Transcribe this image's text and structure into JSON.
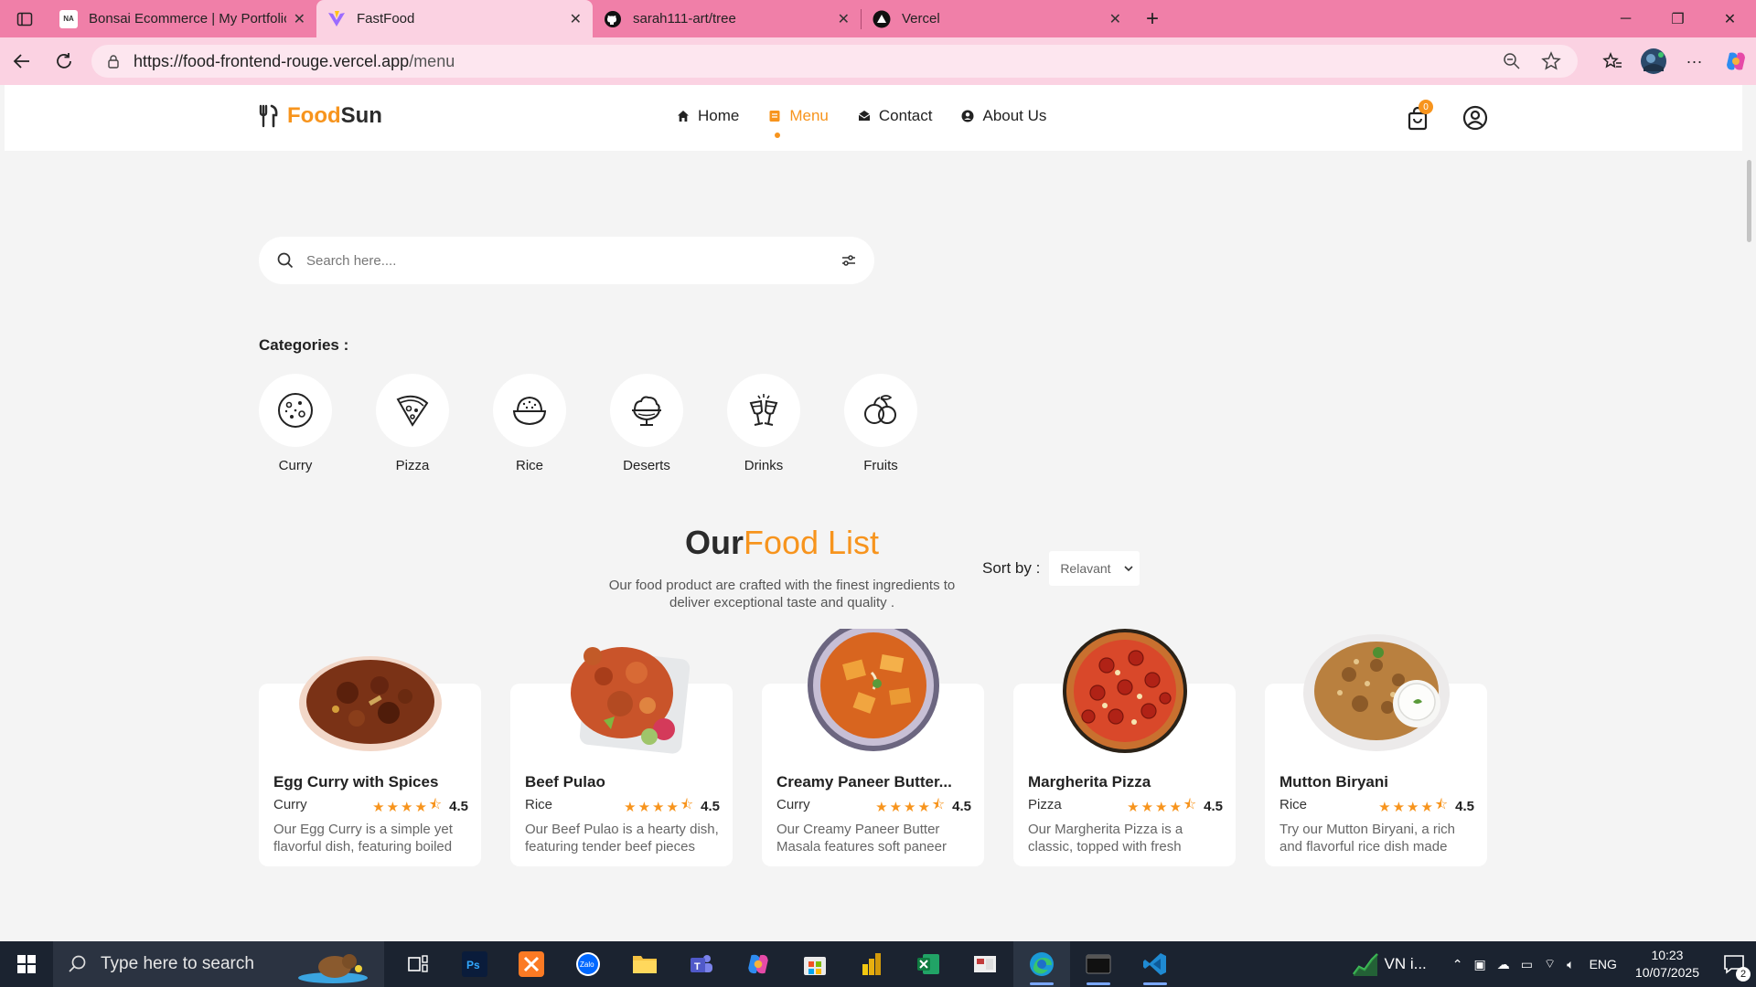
{
  "browser": {
    "tabs": [
      {
        "title": "Bonsai Ecommerce | My Portfolio",
        "icon": "portfolio-icon",
        "active": false
      },
      {
        "title": "FastFood",
        "icon": "vite-icon",
        "active": true
      },
      {
        "title": "sarah111-art/tree",
        "icon": "github-icon",
        "active": false
      },
      {
        "title": "Vercel",
        "icon": "vercel-icon",
        "active": false
      }
    ],
    "url_host": "https://food-frontend-rouge.vercel.app",
    "url_path": "/menu",
    "accent": "#f07fa8"
  },
  "site": {
    "logo_food": "Food",
    "logo_sun": "Sun",
    "nav": [
      {
        "label": "Home",
        "icon": "home-icon",
        "active": false
      },
      {
        "label": "Menu",
        "icon": "menu-icon",
        "active": true
      },
      {
        "label": "Contact",
        "icon": "mail-icon",
        "active": false
      },
      {
        "label": "About Us",
        "icon": "user-circle-icon",
        "active": false
      }
    ],
    "cart_count": "0",
    "brand_color": "#f7941d"
  },
  "search": {
    "placeholder": "Search here...."
  },
  "categories": {
    "title": "Categories :",
    "items": [
      {
        "label": "Curry",
        "icon": "cookie-icon"
      },
      {
        "label": "Pizza",
        "icon": "pizza-icon"
      },
      {
        "label": "Rice",
        "icon": "rice-bowl-icon"
      },
      {
        "label": "Deserts",
        "icon": "ice-cream-icon"
      },
      {
        "label": "Drinks",
        "icon": "cheers-icon"
      },
      {
        "label": "Fruits",
        "icon": "fruits-icon"
      }
    ]
  },
  "food_list": {
    "title_our": "Our",
    "title_rest": "Food List",
    "subtitle": "Our food product are crafted with the finest ingredients to deliver exceptional taste and quality .",
    "sort_label": "Sort by :",
    "sort_value": "Relavant"
  },
  "products": [
    {
      "name": "Egg Curry with Spices",
      "category": "Curry",
      "rating": "4.5",
      "desc": "Our Egg Curry is a simple yet flavorful dish, featuring boiled",
      "image": "curry-dish"
    },
    {
      "name": "Beef Pulao",
      "category": "Rice",
      "rating": "4.5",
      "desc": "Our Beef Pulao is a hearty dish, featuring tender beef pieces",
      "image": "pulao-dish"
    },
    {
      "name": "Creamy Paneer Butter...",
      "category": "Curry",
      "rating": "4.5",
      "desc": "Our Creamy Paneer Butter Masala features soft paneer",
      "image": "paneer-dish"
    },
    {
      "name": "Margherita Pizza",
      "category": "Pizza",
      "rating": "4.5",
      "desc": "Our Margherita Pizza is a classic, topped with fresh",
      "image": "pizza-dish"
    },
    {
      "name": "Mutton Biryani",
      "category": "Rice",
      "rating": "4.5",
      "desc": "Try our Mutton Biryani, a rich and flavorful rice dish made",
      "image": "biryani-dish"
    }
  ],
  "taskbar": {
    "search_placeholder": "Type here to search",
    "stock_label": "VN i...",
    "language": "ENG",
    "time": "10:23",
    "date": "10/07/2025",
    "notifications": "2"
  }
}
